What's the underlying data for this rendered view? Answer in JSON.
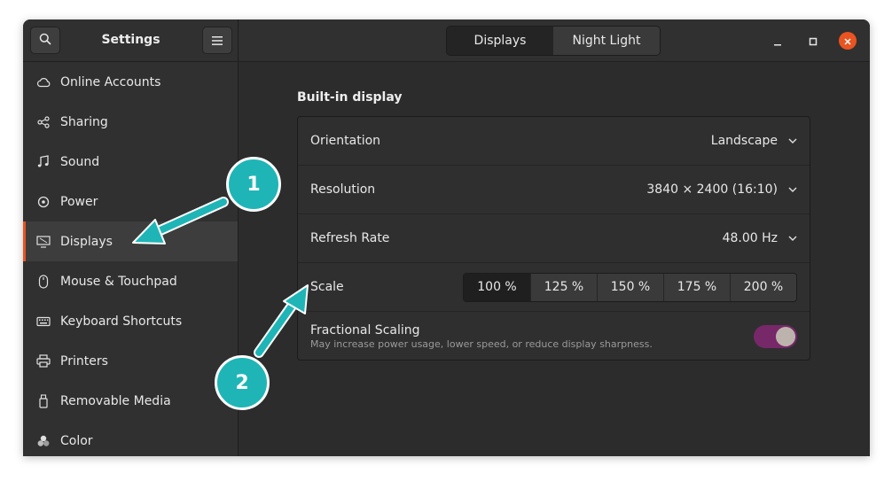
{
  "header": {
    "app_title": "Settings",
    "search_icon": "search-icon",
    "menu_icon": "hamburger-icon",
    "view_switcher": [
      "Displays",
      "Night Light"
    ],
    "active_view": "Displays",
    "window_controls": [
      "minimize",
      "maximize",
      "close"
    ]
  },
  "sidebar": {
    "items": [
      {
        "label": "Online Accounts",
        "icon": "cloud-icon"
      },
      {
        "label": "Sharing",
        "icon": "share-icon"
      },
      {
        "label": "Sound",
        "icon": "music-note-icon"
      },
      {
        "label": "Power",
        "icon": "power-icon"
      },
      {
        "label": "Displays",
        "icon": "display-icon",
        "selected": true
      },
      {
        "label": "Mouse & Touchpad",
        "icon": "mouse-icon"
      },
      {
        "label": "Keyboard Shortcuts",
        "icon": "keyboard-icon"
      },
      {
        "label": "Printers",
        "icon": "printer-icon"
      },
      {
        "label": "Removable Media",
        "icon": "usb-drive-icon"
      },
      {
        "label": "Color",
        "icon": "palette-icon"
      }
    ]
  },
  "main": {
    "section_title": "Built-in display",
    "orientation": {
      "label": "Orientation",
      "value": "Landscape"
    },
    "resolution": {
      "label": "Resolution",
      "value": "3840 × 2400 (16:10)"
    },
    "refresh_rate": {
      "label": "Refresh Rate",
      "value": "48.00 Hz"
    },
    "scale": {
      "label": "Scale",
      "options": [
        "100 %",
        "125 %",
        "150 %",
        "175 %",
        "200 %"
      ],
      "selected": "100 %"
    },
    "fractional_scaling": {
      "label": "Fractional Scaling",
      "description": "May increase power usage, lower speed, or reduce display sharpness.",
      "enabled": true
    }
  },
  "annotations": {
    "callout_1": "1",
    "callout_2": "2"
  },
  "colors": {
    "accent": "#e95420",
    "toggle_on": "#772869",
    "callout": "#1fb5b7"
  }
}
